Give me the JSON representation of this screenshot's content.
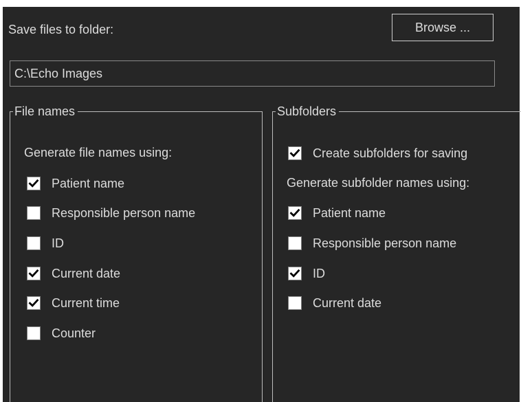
{
  "save": {
    "label": "Save files to folder:",
    "browse_label": "Browse ...",
    "path_value": "C:\\Echo Images"
  },
  "file_names": {
    "title": "File names",
    "intro": "Generate file names using:",
    "options": [
      {
        "label": "Patient name",
        "checked": true
      },
      {
        "label": "Responsible person name",
        "checked": false
      },
      {
        "label": "ID",
        "checked": false
      },
      {
        "label": "Current date",
        "checked": true
      },
      {
        "label": "Current time",
        "checked": true
      },
      {
        "label": "Counter",
        "checked": false
      }
    ]
  },
  "subfolders": {
    "title": "Subfolders",
    "create": {
      "label": "Create subfolders for saving",
      "checked": true
    },
    "intro": "Generate subfolder names using:",
    "options": [
      {
        "label": "Patient name",
        "checked": true
      },
      {
        "label": "Responsible person name",
        "checked": false
      },
      {
        "label": "ID",
        "checked": true
      },
      {
        "label": "Current date",
        "checked": false
      }
    ]
  },
  "colors": {
    "background": "#262626",
    "text": "#dcdcdc",
    "checkbox_fill": "#ffffff",
    "checkmark": "#000000"
  },
  "icons": {
    "checkmark": "checkmark-icon"
  }
}
